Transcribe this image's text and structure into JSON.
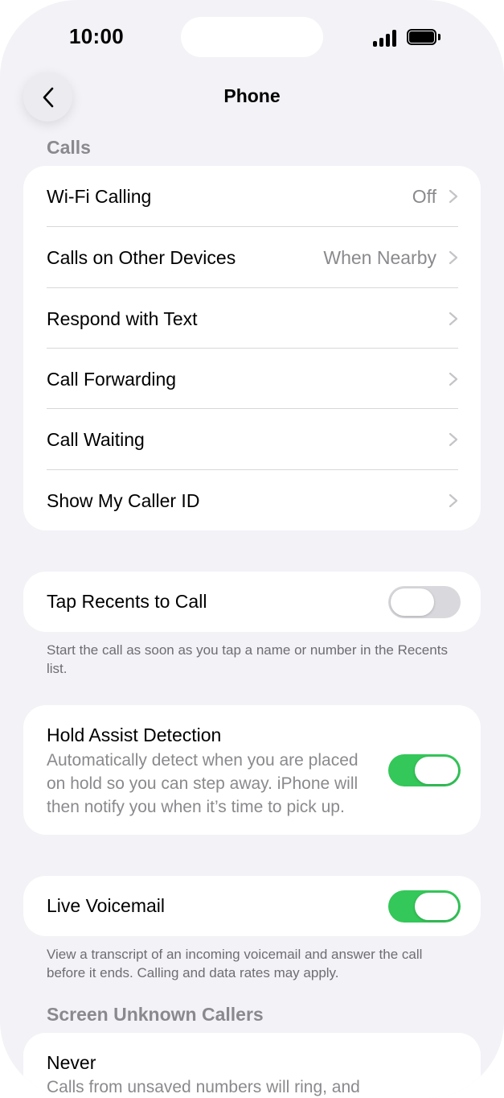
{
  "status_bar": {
    "time": "10:00"
  },
  "nav": {
    "title": "Phone"
  },
  "calls": {
    "header": "Calls",
    "rows": [
      {
        "label": "Wi-Fi Calling",
        "value": "Off"
      },
      {
        "label": "Calls on Other Devices",
        "value": "When Nearby"
      },
      {
        "label": "Respond with Text",
        "value": ""
      },
      {
        "label": "Call Forwarding",
        "value": ""
      },
      {
        "label": "Call Waiting",
        "value": ""
      },
      {
        "label": "Show My Caller ID",
        "value": ""
      }
    ]
  },
  "tap_recents": {
    "label": "Tap Recents to Call",
    "enabled": false,
    "footer": "Start the call as soon as you tap a name or number in the Recents list."
  },
  "hold_assist": {
    "label": "Hold Assist Detection",
    "description_lines": [
      "Automatically detect when you are placed",
      "on hold so you can step away. iPhone will",
      "then notify you when it’s time to pick up."
    ],
    "enabled": true
  },
  "live_voicemail": {
    "label": "Live Voicemail",
    "enabled": true,
    "footer": "View a transcript of an incoming voicemail and answer the call before it ends. Calling and data rates may apply."
  },
  "screen_unknown": {
    "header": "Screen Unknown Callers",
    "option_label": "Never",
    "option_description": "Calls from unsaved numbers will ring, and"
  },
  "colors": {
    "background": "#f2f2f7",
    "toggle_on": "#34c759",
    "toggle_off": "#d9d9dd",
    "secondary_text": "#8a8a8e"
  }
}
